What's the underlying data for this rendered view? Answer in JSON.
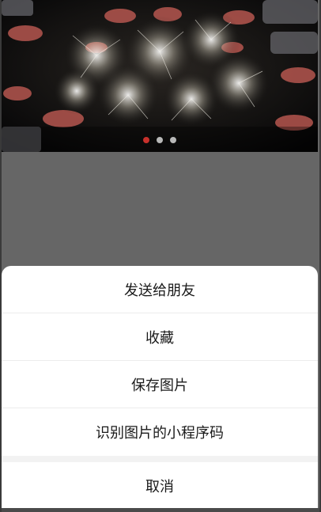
{
  "banner": {
    "image_description": "sparklers held by many hands in the dark",
    "dots": [
      {
        "active": true
      },
      {
        "active": false
      },
      {
        "active": false
      }
    ]
  },
  "action_sheet": {
    "items": [
      {
        "label": "发送给朋友"
      },
      {
        "label": "收藏"
      },
      {
        "label": "保存图片"
      },
      {
        "label": "识别图片的小程序码"
      }
    ],
    "cancel_label": "取消"
  },
  "colors": {
    "mask": "#666666",
    "sheet_bg": "#ffffff",
    "active_dot": "#c7302b",
    "inactive_dot": "#b8b8b8"
  }
}
